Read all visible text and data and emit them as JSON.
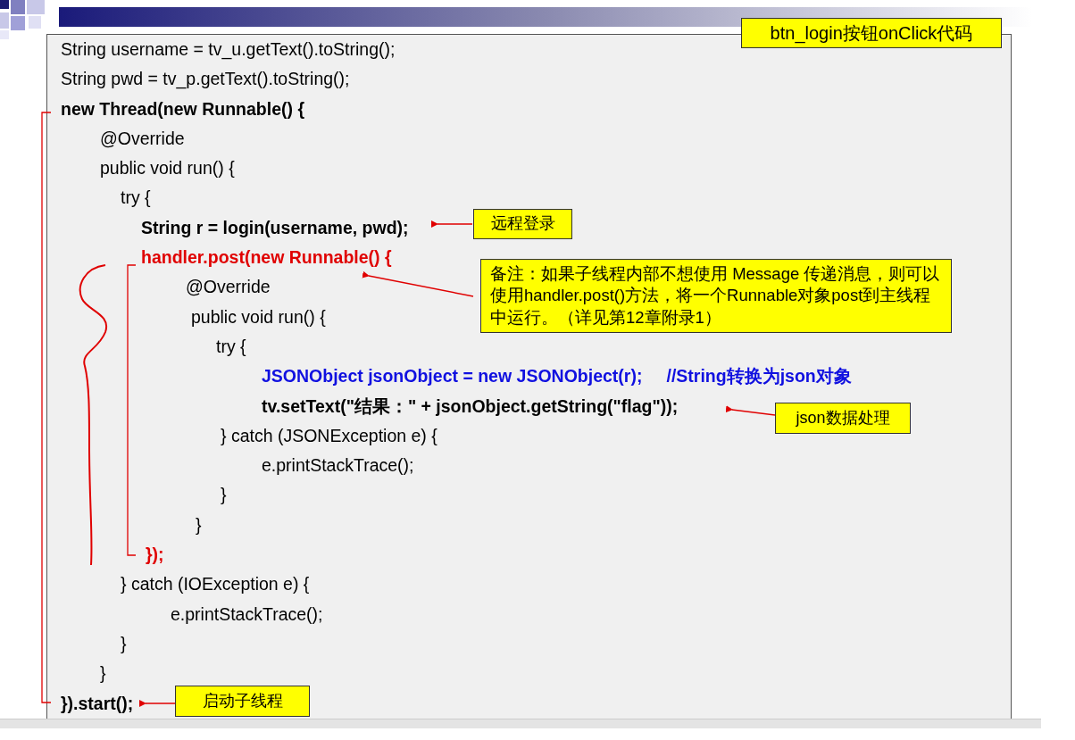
{
  "code_lines": [
    {
      "text": "String username = tv_u.getText().toString();",
      "kind": "plain"
    },
    {
      "text": "String pwd = tv_p.getText().toString();",
      "kind": "plain"
    },
    {
      "text": "new Thread(new Runnable() {",
      "kind": "bold"
    },
    {
      "text": "@Override",
      "kind": "plain"
    },
    {
      "text": "public void run() {",
      "kind": "plain"
    },
    {
      "text": "try {",
      "kind": "plain"
    },
    {
      "text": "String r = login(username, pwd);",
      "kind": "bold"
    },
    {
      "text": "handler.post(new Runnable() {",
      "kind": "red"
    },
    {
      "text": "@Override",
      "kind": "plain"
    },
    {
      "text": "public void run() {",
      "kind": "plain"
    },
    {
      "text": "try {",
      "kind": "plain"
    },
    {
      "text": "JSONObject jsonObject = new JSONObject(r);     //String转换为json对象",
      "kind": "blue"
    },
    {
      "text": "tv.setText(\"结果：\" + jsonObject.getString(\"flag\"));",
      "kind": "bold"
    },
    {
      "text": "} catch (JSONException e) {",
      "kind": "plain"
    },
    {
      "text": "e.printStackTrace();",
      "kind": "plain"
    },
    {
      "text": "}",
      "kind": "plain"
    },
    {
      "text": "}",
      "kind": "plain"
    },
    {
      "text": "});",
      "kind": "red"
    },
    {
      "text": "} catch (IOException e) {",
      "kind": "plain"
    },
    {
      "text": "e.printStackTrace();",
      "kind": "plain"
    },
    {
      "text": "}",
      "kind": "plain"
    },
    {
      "text": "}",
      "kind": "plain"
    },
    {
      "text": "}).start();",
      "kind": "bold"
    }
  ],
  "callouts": [
    {
      "text": "btn_login按钮onClick代码"
    },
    {
      "text": "远程登录"
    },
    {
      "text": "备注：如果子线程内部不想使用 Message 传递消息，则可以使用handler.post()方法，将一个Runnable对象post到主线程中运行。（详见第12章附录1）"
    },
    {
      "text": "json数据处理"
    },
    {
      "text": "启动子线程"
    }
  ]
}
